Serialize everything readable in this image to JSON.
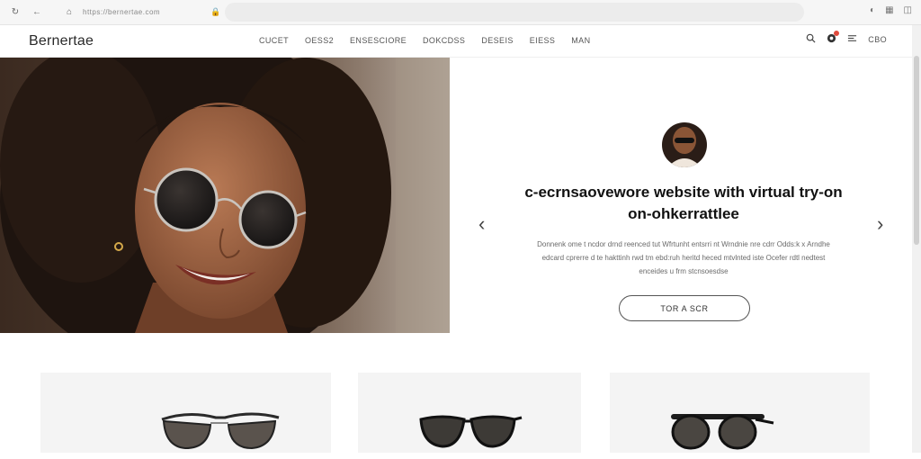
{
  "browser": {
    "url": "https://bernertae.com",
    "address_hint": "",
    "nav_icons": [
      "reload-icon",
      "back-icon",
      "home-icon"
    ],
    "right_icons": [
      "extensions-icon",
      "menu-grid-icon",
      "profile-icon"
    ]
  },
  "header": {
    "brand": "Bernertae",
    "nav": [
      "CUCET",
      "OESS2",
      "ENSESCIORE",
      "DOKCDSS",
      "DESEIS",
      "EIESS",
      "MAN"
    ],
    "currency": "CBO",
    "icons": [
      "search-icon",
      "cart-icon",
      "account-icon"
    ]
  },
  "hero": {
    "title_line1": "c-ecrnsaovewore website with virtual try-on",
    "title_line2": "on-ohkerrattlee",
    "description_line1": "Donnenk ome t ncdor drnd reenced tut Wfrtunht entsrri nt Wrndnie nre cdrr Odds:k x Arndhe",
    "description_line2": "edcard cprerre d te hakttinh rwd tm ebd:ruh heritd heced mtvlnted iste  Ocefer rdtl nedtest",
    "description_line3": "enceides u frm stcnsoesdse",
    "cta_label": "TOR A SCR",
    "prev_label": "‹",
    "next_label": "›"
  },
  "colors": {
    "accent": "#e04a3c",
    "text": "#111111",
    "card_bg": "#f4f4f4"
  }
}
